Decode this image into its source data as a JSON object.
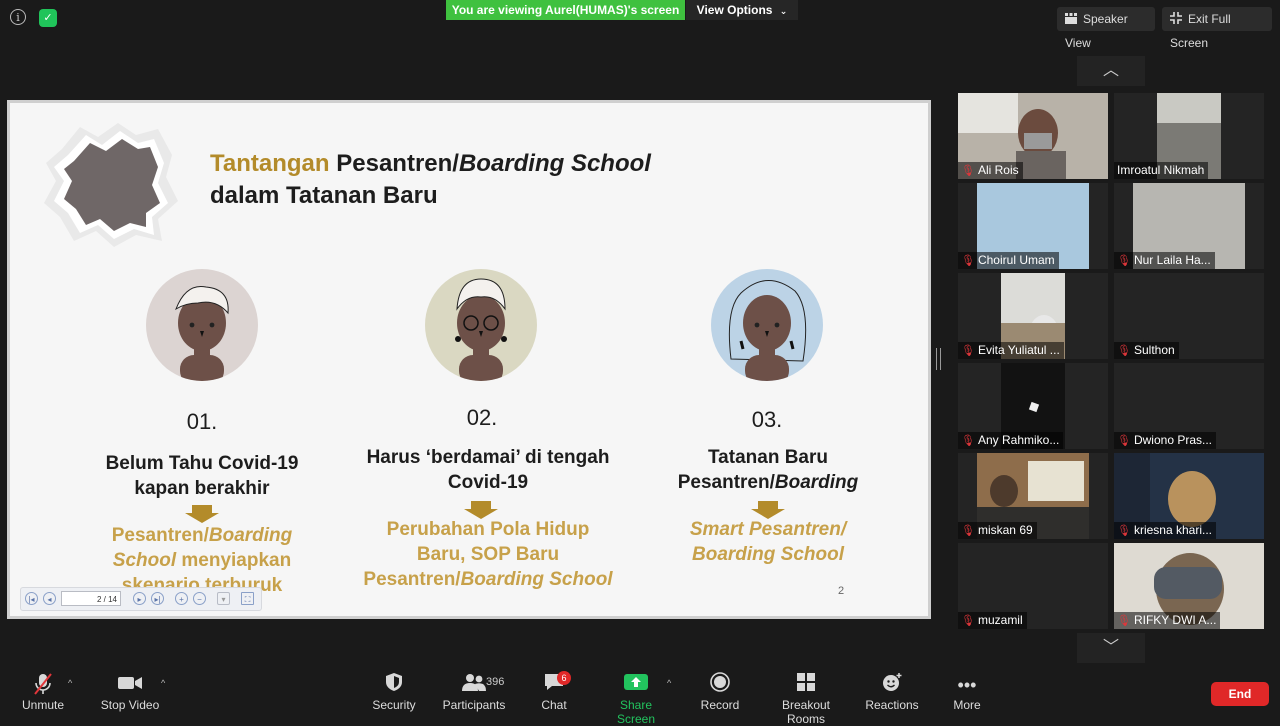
{
  "top_bar": {
    "viewing_banner": "You are viewing Aurel(HUMAS)'s screen",
    "view_options": "View Options",
    "speaker_view": "Speaker View",
    "exit_full_screen": "Exit Full Screen",
    "icons": [
      "info-icon",
      "shield-check-icon",
      "chevron-down-icon",
      "speaker-view-icon",
      "exit-full-screen-icon"
    ]
  },
  "slide": {
    "title_word_1": "Tantangan",
    "title_word_2": "Pesantren/",
    "title_word_3": "Boarding School",
    "title_line_2": "dalam Tatanan Baru",
    "columns": [
      {
        "num": "01.",
        "head_line_1": "Belum Tahu Covid-19",
        "head_line_2": "kapan berakhir",
        "sub_line_1a": "Pesantren/",
        "sub_line_1b": "Boarding",
        "sub_line_2a": "School",
        "sub_line_2b": " menyiapkan",
        "sub_line_3": "skenario terburuk"
      },
      {
        "num": "02.",
        "head_line_1": "Harus ‘berdamai’ di tengah",
        "head_line_2": "Covid-19",
        "sub_line_1": "Perubahan Pola Hidup",
        "sub_line_2": "Baru, SOP Baru",
        "sub_line_3a": "Pesantren/",
        "sub_line_3b": "Boarding School"
      },
      {
        "num": "03.",
        "head_line_1": "Tatanan Baru",
        "head_line_2a": "Pesantren/",
        "head_line_2b": "Boarding",
        "sub_line_1": "Smart Pesantren/",
        "sub_line_2": "Boarding School"
      }
    ],
    "page_number": "2",
    "pdf_toolbar": {
      "page_field": "2 / 14"
    }
  },
  "gallery": {
    "participants": [
      {
        "name": "Ali Rois"
      },
      {
        "name": "Imroatul Nikmah"
      },
      {
        "name": "Choirul Umam"
      },
      {
        "name": "Nur Laila Ha..."
      },
      {
        "name": "Evita Yuliatul ..."
      },
      {
        "name": "Sulthon"
      },
      {
        "name": "Any Rahmiko..."
      },
      {
        "name": "Dwiono Pras..."
      },
      {
        "name": "miskan 69"
      },
      {
        "name": "kriesna khari..."
      },
      {
        "name": "muzamil"
      },
      {
        "name": "RIFKY DWI A..."
      }
    ],
    "mic_status": "muted"
  },
  "toolbar": {
    "unmute": "Unmute",
    "stop_video": "Stop Video",
    "security": "Security",
    "participants": "Participants",
    "participants_count": "396",
    "chat": "Chat",
    "chat_badge": "6",
    "share_screen": "Share Screen",
    "record": "Record",
    "breakout_rooms": "Breakout Rooms",
    "reactions": "Reactions",
    "more": "More",
    "end": "End"
  },
  "colors": {
    "accent_green": "#3fc13f",
    "end_red": "#e02828",
    "slide_gold": "#b38b2a",
    "share_green": "#22c35e"
  }
}
